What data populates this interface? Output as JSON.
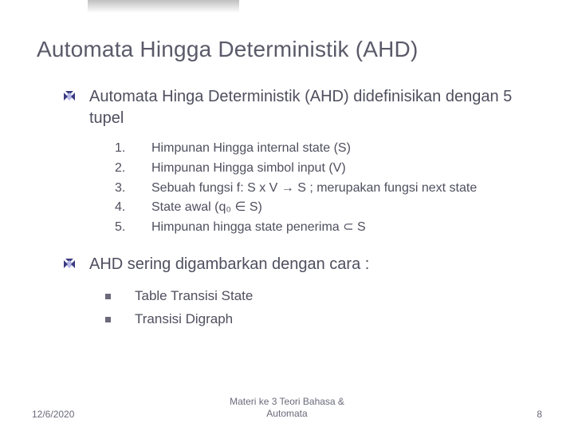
{
  "title": "Automata Hingga Deterministik (AHD)",
  "bullets": [
    {
      "text": " Automata Hinga Deterministik (AHD) didefinisikan dengan 5 tupel",
      "ordered": [
        "Himpunan Hingga internal state (S)",
        "Himpunan Hingga simbol input (V)",
        "Sebuah fungsi f: S x V → S ; merupakan fungsi next state",
        "State awal (q₀ ∈ S)",
        "Himpunan hingga state penerima ⊂ S"
      ]
    },
    {
      "text": "AHD sering digambarkan dengan cara :",
      "sub": [
        "Table Transisi State",
        "Transisi Digraph"
      ]
    }
  ],
  "num_labels": [
    "1.",
    "2.",
    "3.",
    "4.",
    "5."
  ],
  "footer": {
    "date": "12/6/2020",
    "center": "Materi ke 3 Teori Bahasa &\nAutomata",
    "page": "8"
  },
  "colors": {
    "diamond_dark": "#3a3a80",
    "diamond_light": "#b8b8e8"
  }
}
